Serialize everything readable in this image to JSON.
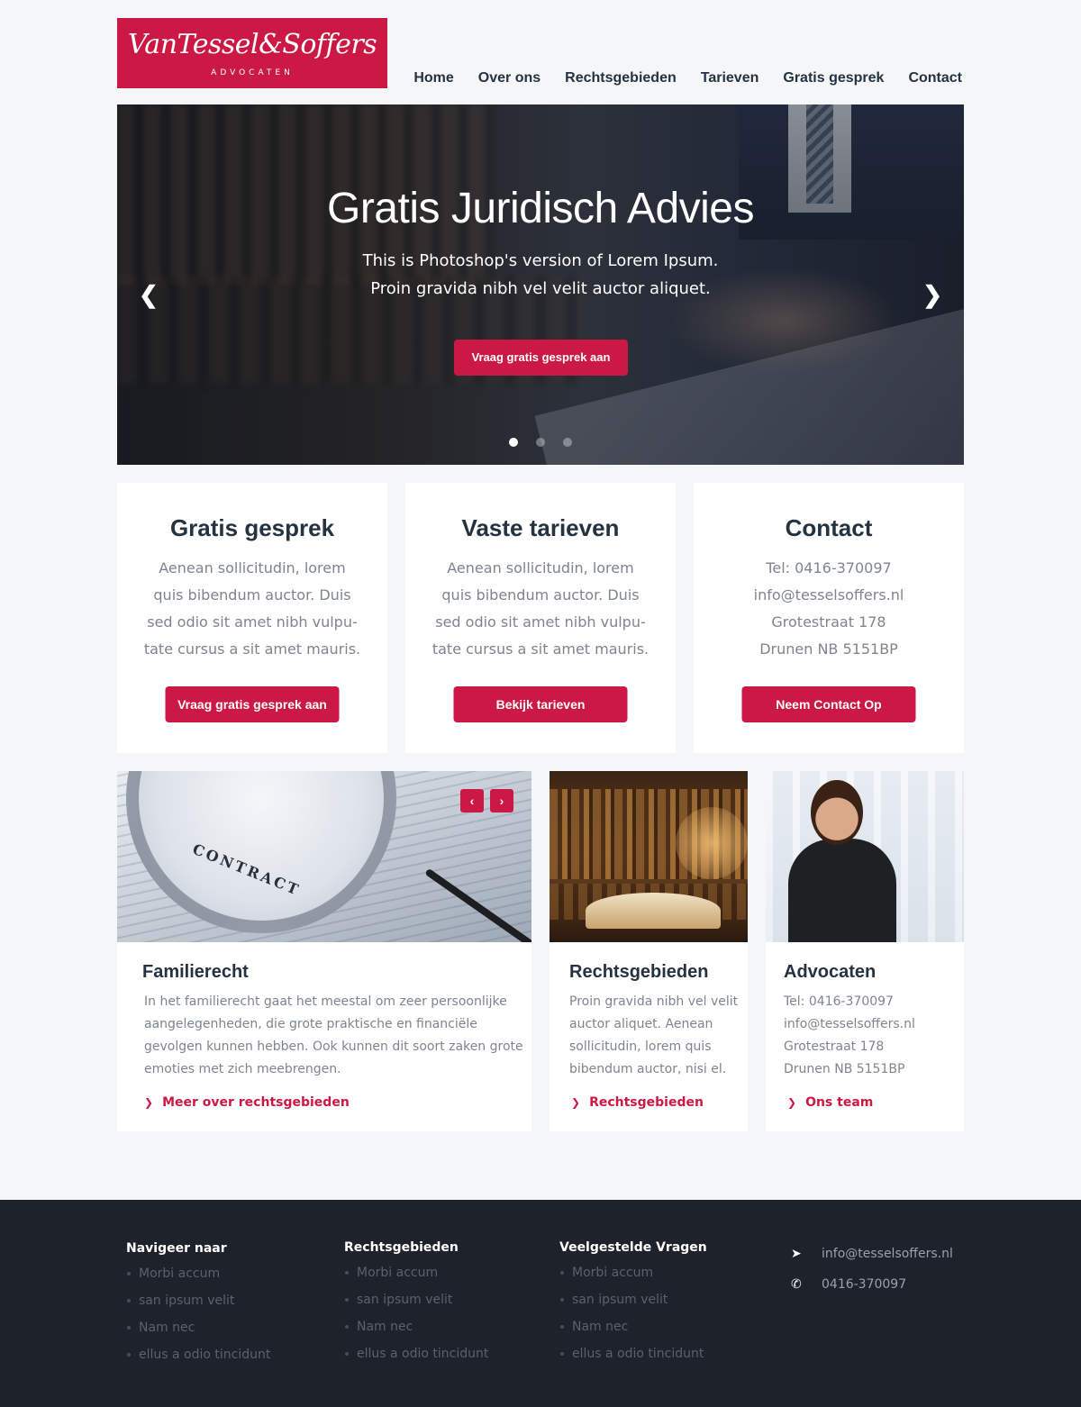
{
  "header": {
    "logo_script": "VanTessel&Soffers",
    "logo_sub": "ADVOCATEN",
    "nav": [
      "Home",
      "Over ons",
      "Rechtsgebieden",
      "Tarieven",
      "Gratis gesprek",
      "Contact"
    ]
  },
  "hero": {
    "title": "Gratis Juridisch Advies",
    "line1": "This is Photoshop's version  of Lorem Ipsum.",
    "line2": "Proin gravida nibh vel velit auctor aliquet.",
    "button": "Vraag gratis gesprek aan",
    "prev_icon": "chevron-left-icon",
    "next_icon": "chevron-right-icon",
    "slides": 3,
    "active_slide": 1
  },
  "cards": [
    {
      "title": "Gratis gesprek",
      "lines": [
        "Aenean sollicitudin, lorem",
        "quis bibendum auctor. Duis",
        "sed odio sit amet nibh vulpu-",
        "tate cursus a sit amet mauris."
      ],
      "button": "Vraag gratis gesprek aan"
    },
    {
      "title": "Vaste tarieven",
      "lines": [
        "Aenean sollicitudin, lorem",
        "quis bibendum auctor. Duis",
        "sed odio sit amet nibh vulpu-",
        "tate cursus a sit amet mauris."
      ],
      "button": "Bekijk tarieven"
    },
    {
      "title": "Contact",
      "lines": [
        "Tel: 0416-370097",
        "info@tesselsoffers.nl",
        "Grotestraat 178",
        "Drunen NB 5151BP"
      ],
      "button": "Neem Contact Op"
    }
  ],
  "tiles": [
    {
      "title": "Familierecht",
      "lines": [
        "In het familierecht gaat het meestal om zeer persoonlijke",
        "aangelegenheden, die grote praktische en financiële",
        "gevolgen kunnen hebben. Ook kunnen dit soort zaken grote",
        "emoties met zich meebrengen."
      ],
      "link": "Meer over rechtsgebieden",
      "image_text": "CONTRACT"
    },
    {
      "title": "Rechtsgebieden",
      "lines": [
        "Proin gravida nibh vel velit",
        "auctor aliquet. Aenean",
        "sollicitudin, lorem quis",
        "bibendum auctor, nisi el."
      ],
      "link": "Rechtsgebieden"
    },
    {
      "title": "Advocaten",
      "lines": [
        "Tel: 0416-370097",
        "info@tesselsoffers.nl",
        "Grotestraat 178",
        "Drunen NB 5151BP"
      ],
      "link": "Ons team"
    }
  ],
  "footer": {
    "columns": [
      {
        "title": "Navigeer naar",
        "items": [
          "Morbi accum",
          "san ipsum velit",
          "Nam nec",
          "ellus a odio tincidunt"
        ]
      },
      {
        "title": "Rechtsgebieden",
        "items": [
          "Morbi accum",
          "san ipsum velit",
          "Nam nec",
          "ellus a odio tincidunt"
        ]
      },
      {
        "title": "Veelgestelde Vragen",
        "items": [
          "Morbi accum",
          "san ipsum velit",
          "Nam nec",
          "ellus a odio tincidunt"
        ]
      }
    ],
    "email": "info@tesselsoffers.nl",
    "phone": "0416-370097",
    "email_icon": "paper-plane-icon",
    "phone_icon": "phone-icon"
  },
  "colors": {
    "accent": "#cc1844",
    "heading": "#253240",
    "body_text": "#7d8590",
    "background": "#f5f6f8",
    "footer_bg": "#1d222b"
  }
}
